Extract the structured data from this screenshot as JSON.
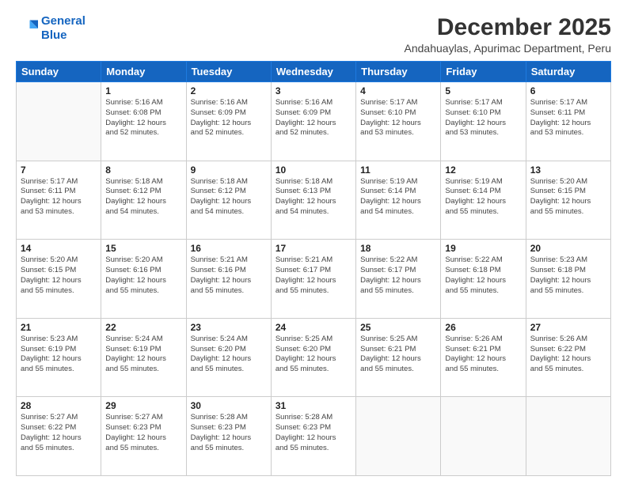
{
  "logo": {
    "line1": "General",
    "line2": "Blue"
  },
  "title": "December 2025",
  "subtitle": "Andahuaylas, Apurimac Department, Peru",
  "weekdays": [
    "Sunday",
    "Monday",
    "Tuesday",
    "Wednesday",
    "Thursday",
    "Friday",
    "Saturday"
  ],
  "weeks": [
    [
      {
        "day": "",
        "info": ""
      },
      {
        "day": "1",
        "info": "Sunrise: 5:16 AM\nSunset: 6:08 PM\nDaylight: 12 hours\nand 52 minutes."
      },
      {
        "day": "2",
        "info": "Sunrise: 5:16 AM\nSunset: 6:09 PM\nDaylight: 12 hours\nand 52 minutes."
      },
      {
        "day": "3",
        "info": "Sunrise: 5:16 AM\nSunset: 6:09 PM\nDaylight: 12 hours\nand 52 minutes."
      },
      {
        "day": "4",
        "info": "Sunrise: 5:17 AM\nSunset: 6:10 PM\nDaylight: 12 hours\nand 53 minutes."
      },
      {
        "day": "5",
        "info": "Sunrise: 5:17 AM\nSunset: 6:10 PM\nDaylight: 12 hours\nand 53 minutes."
      },
      {
        "day": "6",
        "info": "Sunrise: 5:17 AM\nSunset: 6:11 PM\nDaylight: 12 hours\nand 53 minutes."
      }
    ],
    [
      {
        "day": "7",
        "info": "Sunrise: 5:17 AM\nSunset: 6:11 PM\nDaylight: 12 hours\nand 53 minutes."
      },
      {
        "day": "8",
        "info": "Sunrise: 5:18 AM\nSunset: 6:12 PM\nDaylight: 12 hours\nand 54 minutes."
      },
      {
        "day": "9",
        "info": "Sunrise: 5:18 AM\nSunset: 6:12 PM\nDaylight: 12 hours\nand 54 minutes."
      },
      {
        "day": "10",
        "info": "Sunrise: 5:18 AM\nSunset: 6:13 PM\nDaylight: 12 hours\nand 54 minutes."
      },
      {
        "day": "11",
        "info": "Sunrise: 5:19 AM\nSunset: 6:14 PM\nDaylight: 12 hours\nand 54 minutes."
      },
      {
        "day": "12",
        "info": "Sunrise: 5:19 AM\nSunset: 6:14 PM\nDaylight: 12 hours\nand 55 minutes."
      },
      {
        "day": "13",
        "info": "Sunrise: 5:20 AM\nSunset: 6:15 PM\nDaylight: 12 hours\nand 55 minutes."
      }
    ],
    [
      {
        "day": "14",
        "info": "Sunrise: 5:20 AM\nSunset: 6:15 PM\nDaylight: 12 hours\nand 55 minutes."
      },
      {
        "day": "15",
        "info": "Sunrise: 5:20 AM\nSunset: 6:16 PM\nDaylight: 12 hours\nand 55 minutes."
      },
      {
        "day": "16",
        "info": "Sunrise: 5:21 AM\nSunset: 6:16 PM\nDaylight: 12 hours\nand 55 minutes."
      },
      {
        "day": "17",
        "info": "Sunrise: 5:21 AM\nSunset: 6:17 PM\nDaylight: 12 hours\nand 55 minutes."
      },
      {
        "day": "18",
        "info": "Sunrise: 5:22 AM\nSunset: 6:17 PM\nDaylight: 12 hours\nand 55 minutes."
      },
      {
        "day": "19",
        "info": "Sunrise: 5:22 AM\nSunset: 6:18 PM\nDaylight: 12 hours\nand 55 minutes."
      },
      {
        "day": "20",
        "info": "Sunrise: 5:23 AM\nSunset: 6:18 PM\nDaylight: 12 hours\nand 55 minutes."
      }
    ],
    [
      {
        "day": "21",
        "info": "Sunrise: 5:23 AM\nSunset: 6:19 PM\nDaylight: 12 hours\nand 55 minutes."
      },
      {
        "day": "22",
        "info": "Sunrise: 5:24 AM\nSunset: 6:19 PM\nDaylight: 12 hours\nand 55 minutes."
      },
      {
        "day": "23",
        "info": "Sunrise: 5:24 AM\nSunset: 6:20 PM\nDaylight: 12 hours\nand 55 minutes."
      },
      {
        "day": "24",
        "info": "Sunrise: 5:25 AM\nSunset: 6:20 PM\nDaylight: 12 hours\nand 55 minutes."
      },
      {
        "day": "25",
        "info": "Sunrise: 5:25 AM\nSunset: 6:21 PM\nDaylight: 12 hours\nand 55 minutes."
      },
      {
        "day": "26",
        "info": "Sunrise: 5:26 AM\nSunset: 6:21 PM\nDaylight: 12 hours\nand 55 minutes."
      },
      {
        "day": "27",
        "info": "Sunrise: 5:26 AM\nSunset: 6:22 PM\nDaylight: 12 hours\nand 55 minutes."
      }
    ],
    [
      {
        "day": "28",
        "info": "Sunrise: 5:27 AM\nSunset: 6:22 PM\nDaylight: 12 hours\nand 55 minutes."
      },
      {
        "day": "29",
        "info": "Sunrise: 5:27 AM\nSunset: 6:23 PM\nDaylight: 12 hours\nand 55 minutes."
      },
      {
        "day": "30",
        "info": "Sunrise: 5:28 AM\nSunset: 6:23 PM\nDaylight: 12 hours\nand 55 minutes."
      },
      {
        "day": "31",
        "info": "Sunrise: 5:28 AM\nSunset: 6:23 PM\nDaylight: 12 hours\nand 55 minutes."
      },
      {
        "day": "",
        "info": ""
      },
      {
        "day": "",
        "info": ""
      },
      {
        "day": "",
        "info": ""
      }
    ]
  ]
}
